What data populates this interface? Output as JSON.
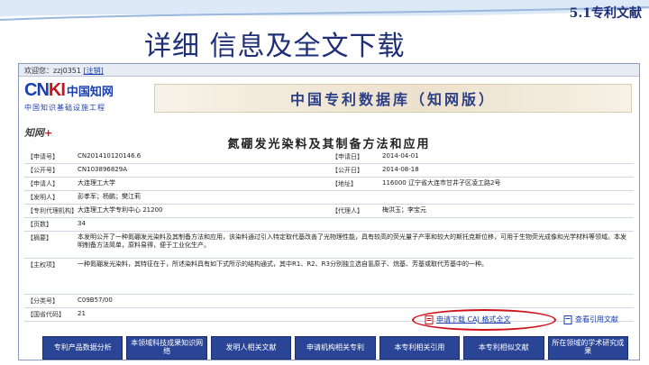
{
  "slide": {
    "tag": "5.1专利文献",
    "title": "详细 信息及全文下载"
  },
  "topbar": {
    "welcome": "欢迎您：zzj0351",
    "logout": "[注销]"
  },
  "logo": {
    "latin_a": "CN",
    "latin_b": "KI",
    "cn": "中国知网",
    "sub": "中国知识基础设施工程"
  },
  "banner": {
    "title": "中国专利数据库（知网版）"
  },
  "brand_mark": {
    "main": "知网",
    "accent": "+"
  },
  "patent": {
    "title": "氮硼发光染料及其制备方法和应用"
  },
  "fields": {
    "app_no_label": "【申请号】",
    "app_no": "CN201410120146.6",
    "app_date_label": "【申请日】",
    "app_date": "2014-04-01",
    "pub_no_label": "【公开号】",
    "pub_no": "CN103896829A",
    "pub_date_label": "【公开日】",
    "pub_date": "2014-08-18",
    "applicant_label": "【申请人】",
    "applicant": "大连理工大学",
    "address_label": "【地址】",
    "address": "116000 辽宁省大连市甘井子区凌工路2号",
    "inventor_label": "【发明人】",
    "inventor": "彭孝军；杨鹏；樊江莉",
    "agency_label": "【专利代理机构】",
    "agency": "大连理工大学专利中心 21200",
    "agent_label": "【代理人】",
    "agent": "梅洪玉；李宝元",
    "pages_label": "【页数】",
    "pages": "34",
    "abstract_label": "【摘要】",
    "abstract": "本发明公开了一种氮硼发光染料及其制备方法和应用，该染料通过引入特定取代基改善了光物理性能，具有较高的荧光量子产率和较大的斯托克斯位移，可用于生物荧光成像和光学材料等领域。本发明制备方法简单，原料易得，便于工业化生产。",
    "claims_label": "【主权项】",
    "claims": "一种氮硼发光染料，其特征在于，所述染料具有如下式所示的结构通式，其中R1、R2、R3分别独立选自氢原子、烷基、芳基或取代芳基中的一种。",
    "ipc_label": "【分类号】",
    "ipc": "C09B57/00",
    "country_label": "【国省代码】",
    "country": "21"
  },
  "download": {
    "label": "申请下载 CAJ 格式全文",
    "view": "查看引用文献"
  },
  "nav": {
    "b1": "专利产品数据分析",
    "b2": "本领域科技成果知识网络",
    "b3": "发明人相关文献",
    "b4": "申请机构相关专利",
    "b5": "本专利相关引用",
    "b6": "本专利相似文献",
    "b7": "所在领域的学术研究成果"
  },
  "colors": {
    "title_blue": "#1e2f78",
    "link_blue": "#1a3fb0",
    "nav_blue": "#2a4496",
    "highlight_red": "#d0141c"
  }
}
